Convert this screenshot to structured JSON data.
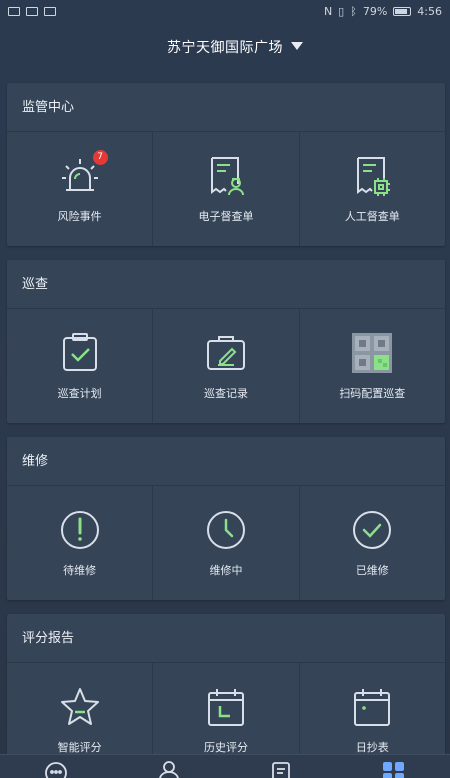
{
  "status": {
    "battery": "79%",
    "time": "4:56"
  },
  "header": {
    "title": "苏宁天御国际广场"
  },
  "colors": {
    "accent": "#8ce08a",
    "icon": "#d9dfe8",
    "badge": "#e53935"
  },
  "sections": [
    {
      "title": "监管中心",
      "items": [
        {
          "label": "风险事件",
          "icon": "alarm-icon",
          "badge": "7"
        },
        {
          "label": "电子督查单",
          "icon": "e-inspection-order-icon"
        },
        {
          "label": "人工督查单",
          "icon": "manual-inspection-order-icon"
        }
      ]
    },
    {
      "title": "巡查",
      "items": [
        {
          "label": "巡查计划",
          "icon": "patrol-plan-icon"
        },
        {
          "label": "巡查记录",
          "icon": "patrol-record-icon"
        },
        {
          "label": "扫码配置巡查",
          "icon": "qr-code-icon"
        }
      ]
    },
    {
      "title": "维修",
      "items": [
        {
          "label": "待维修",
          "icon": "pending-repair-icon"
        },
        {
          "label": "维修中",
          "icon": "repairing-clock-icon"
        },
        {
          "label": "已维修",
          "icon": "repaired-check-icon"
        }
      ]
    },
    {
      "title": "评分报告",
      "items": [
        {
          "label": "智能评分",
          "icon": "smart-score-star-icon"
        },
        {
          "label": "历史评分",
          "icon": "history-score-calendar-icon"
        },
        {
          "label": "日抄表",
          "icon": "daily-meter-calendar-icon"
        }
      ]
    }
  ],
  "bottom_nav": [
    {
      "icon": "chat-icon"
    },
    {
      "icon": "user-icon"
    },
    {
      "icon": "list-icon"
    },
    {
      "icon": "apps-grid-icon",
      "active": true
    }
  ]
}
